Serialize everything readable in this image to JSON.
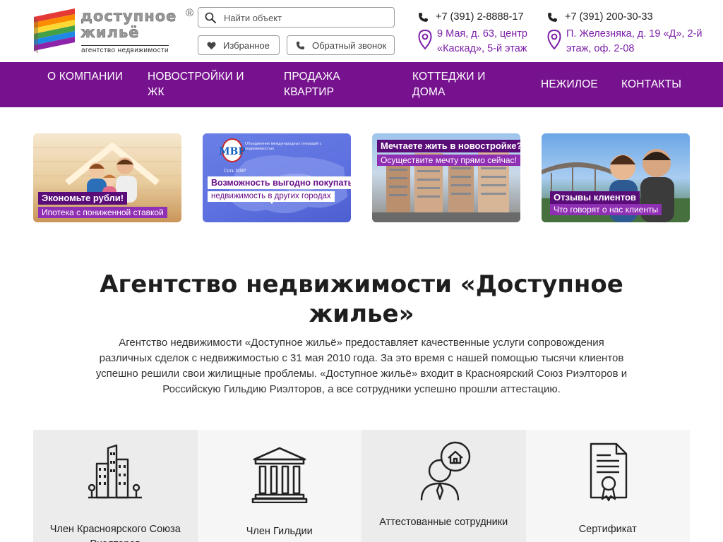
{
  "logo": {
    "word1": "доступное",
    "word2": "жильё",
    "reg": "®",
    "subtitle": "агентство недвижимости"
  },
  "search": {
    "placeholder": "Найти объект"
  },
  "buttons": {
    "favorites": "Избранное",
    "callback": "Обратный звонок"
  },
  "contacts": [
    {
      "phone": "+7 (391) 2-8888-17",
      "address": "9 Мая, д. 63, центр «Каскад», 5-й этаж"
    },
    {
      "phone": "+7 (391) 200-30-33",
      "address": "П. Железняка, д. 19 «Д», 2-й этаж, оф. 2-08"
    }
  ],
  "nav": [
    {
      "label": "О компании"
    },
    {
      "label": "Новостройки и ЖК"
    },
    {
      "label": "Продажа квартир"
    },
    {
      "label": "Коттеджи и дома"
    },
    {
      "label": "Нежилое"
    },
    {
      "label": "Контакты"
    }
  ],
  "banners": [
    {
      "headline": "Экономьте рубли!",
      "subline": "Ипотека с пониженной ставкой"
    },
    {
      "headline": "Возможность выгодно покупать",
      "subline": "недвижимость в других городах",
      "map_label": "Сеть МВР",
      "map_caption": "Объединение международных операций с недвижимостью"
    },
    {
      "headline": "Мечтаете жить в новостройке?",
      "subline": "Осуществите мечту прямо сейчас!"
    },
    {
      "headline": "Отзывы клиентов",
      "subline": "Что говорят о нас клиенты"
    }
  ],
  "heading": "Агентство недвижимости «Доступное жилье»",
  "intro": "Агентство недвижимости «Доступное жильё» предоставляет качественные услуги сопровождения различных сделок с недвижимостью с 31 мая 2010 года. За это время с нашей помощью тысячи клиентов успешно решили свои жилищные проблемы. «Доступное жильё» входит в Красноярский Союз Риэлторов и Российскую Гильдию Риэлторов, а все сотрудники успешно прошли аттестацию.",
  "features": [
    {
      "label": "Член Красноярского Союза Риэлторов",
      "icon": "buildings-icon"
    },
    {
      "label": "Член Гильдии",
      "icon": "columns-building-icon"
    },
    {
      "label": "Аттестованные сотрудники",
      "icon": "agent-house-icon"
    },
    {
      "label": "Сертификат",
      "icon": "certificate-icon"
    }
  ],
  "colors": {
    "brand_purple": "#77128f",
    "address_purple": "#7c1fa8"
  }
}
